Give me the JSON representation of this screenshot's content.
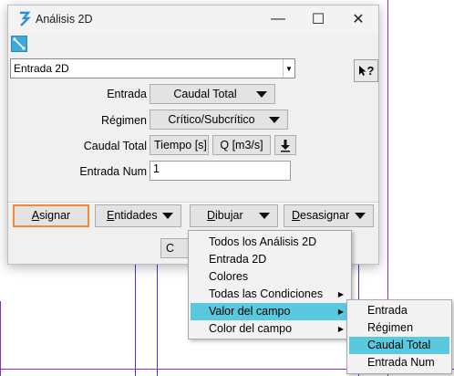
{
  "window": {
    "title": "Análisis 2D",
    "minimize_glyph": "—",
    "maximize_glyph": "☐",
    "close_glyph": "✕"
  },
  "condition_combo": {
    "value": "Entrada 2D"
  },
  "help_button": {
    "label": "?"
  },
  "form": {
    "entrada": {
      "label": "Entrada",
      "value": "Caudal Total"
    },
    "regimen": {
      "label": "Régimen",
      "value": "Crítico/Subcrítico"
    },
    "caudal_total": {
      "label": "Caudal Total",
      "time_button": "Tiempo [s]",
      "q_button": "Q [m3/s]"
    },
    "entrada_num": {
      "label": "Entrada Num",
      "value": "1"
    }
  },
  "buttons": {
    "assign": {
      "prefix": "A",
      "rest": "signar"
    },
    "entities": {
      "prefix": "E",
      "rest": "ntidades"
    },
    "draw": {
      "prefix": "D",
      "rest": "ibujar"
    },
    "unassign": {
      "prefix": "D",
      "rest": "esasignar"
    },
    "close_partial": "C"
  },
  "draw_menu": {
    "items": [
      "Todos los Análisis 2D",
      "Entrada 2D",
      "Colores",
      "Todas las Condiciones",
      "Valor del campo",
      "Color del campo"
    ]
  },
  "field_value_submenu": {
    "items": [
      "Entrada",
      "Régimen",
      "Caudal Total",
      "Entrada Num"
    ]
  },
  "colors": {
    "highlight": "#59c9e0",
    "accent_border": "#f08a3c"
  }
}
